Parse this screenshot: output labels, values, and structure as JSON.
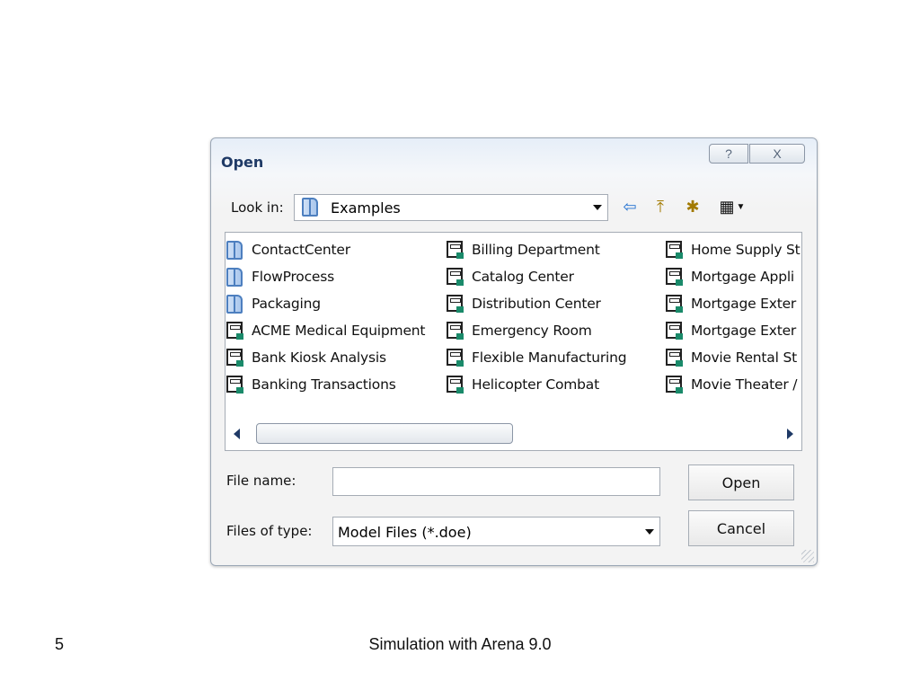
{
  "dialog": {
    "title": "Open",
    "title_buttons": {
      "help": "?",
      "close": "X"
    },
    "look_in": {
      "label": "Look in:",
      "value": "Examples"
    },
    "toolbar": [
      {
        "icon": "back-arrow-icon",
        "glyph": "⇦"
      },
      {
        "icon": "up-folder-icon",
        "glyph": "⤒"
      },
      {
        "icon": "new-folder-icon",
        "glyph": "✱"
      },
      {
        "icon": "view-menu-icon",
        "glyph": "▦"
      }
    ],
    "files": {
      "col1": [
        {
          "name": "ContactCenter",
          "type": "folder"
        },
        {
          "name": "FlowProcess",
          "type": "folder"
        },
        {
          "name": "Packaging",
          "type": "folder"
        },
        {
          "name": "ACME Medical Equipment",
          "type": "model"
        },
        {
          "name": "Bank Kiosk Analysis",
          "type": "model"
        },
        {
          "name": "Banking Transactions",
          "type": "model"
        }
      ],
      "col2": [
        {
          "name": "Billing Department",
          "type": "model"
        },
        {
          "name": "Catalog Center",
          "type": "model"
        },
        {
          "name": "Distribution Center",
          "type": "model"
        },
        {
          "name": "Emergency Room",
          "type": "model"
        },
        {
          "name": "Flexible Manufacturing",
          "type": "model"
        },
        {
          "name": "Helicopter Combat",
          "type": "model"
        }
      ],
      "col3": [
        {
          "name": "Home Supply St",
          "type": "model"
        },
        {
          "name": "Mortgage Appli",
          "type": "model"
        },
        {
          "name": "Mortgage Exter",
          "type": "model"
        },
        {
          "name": "Mortgage Exter",
          "type": "model"
        },
        {
          "name": "Movie Rental St",
          "type": "model"
        },
        {
          "name": "Movie Theater /",
          "type": "model"
        }
      ]
    },
    "file_name": {
      "label": "File name:",
      "value": ""
    },
    "file_type": {
      "label": "Files of type:",
      "value": "Model Files (*.doe)"
    },
    "buttons": {
      "open": "Open",
      "cancel": "Cancel"
    }
  },
  "footer": {
    "page_number": "5",
    "title": "Simulation with Arena 9.0"
  }
}
